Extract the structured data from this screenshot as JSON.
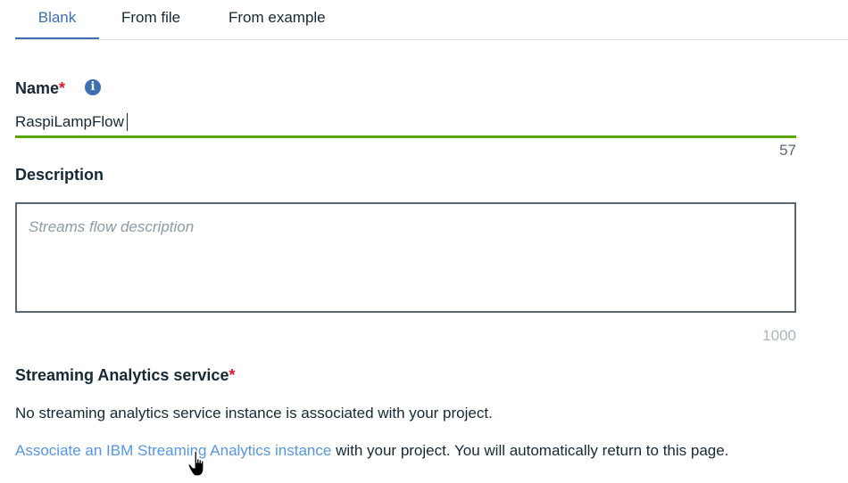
{
  "tabs": [
    {
      "label": "Blank",
      "active": true
    },
    {
      "label": "From file",
      "active": false
    },
    {
      "label": "From example",
      "active": false
    }
  ],
  "name_field": {
    "label": "Name",
    "required_marker": "*",
    "value": "RaspiLampFlow",
    "remaining": "57",
    "info_icon": "info-icon",
    "focus_color": "#5aa700"
  },
  "description_field": {
    "label": "Description",
    "placeholder": "Streams flow description",
    "remaining": "1000"
  },
  "service": {
    "label": "Streaming Analytics service",
    "required_marker": "*",
    "message": "No streaming analytics service instance is associated with your project.",
    "link_text": "Associate an IBM Streaming Analytics instance",
    "link_suffix": " with your project. You will automatically return to this page."
  },
  "colors": {
    "accent": "#3d70b2",
    "link": "#5596e6",
    "required": "#e0182d"
  },
  "cursor": "hand-pointer-icon"
}
